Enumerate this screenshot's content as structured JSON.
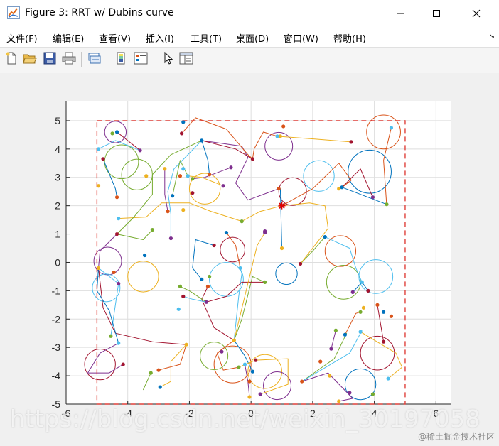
{
  "window": {
    "title": "Figure 3: RRT w/ Dubins curve",
    "minimize_icon": "minimize-icon",
    "maximize_icon": "maximize-icon",
    "close_icon": "close-icon"
  },
  "menu": {
    "items": [
      "文件(F)",
      "编辑(E)",
      "查看(V)",
      "插入(I)",
      "工具(T)",
      "桌面(D)",
      "窗口(W)",
      "帮助(H)"
    ]
  },
  "toolbar": {
    "icons": [
      "new-figure-icon",
      "open-file-icon",
      "save-icon",
      "print-icon",
      "link-plot-icon",
      "colorbar-icon",
      "legend-icon",
      "select-arrow-icon",
      "property-inspector-icon"
    ]
  },
  "chart_data": {
    "type": "line",
    "title": "",
    "xlabel": "",
    "ylabel": "",
    "xlim": [
      -6,
      6.5
    ],
    "ylim": [
      -5,
      5.7
    ],
    "xticks": [
      -6,
      -4,
      -2,
      0,
      2,
      4,
      6
    ],
    "yticks": [
      5,
      4,
      3,
      2,
      1,
      0,
      -1,
      -2,
      -3,
      -4,
      -5
    ],
    "grid": true,
    "boundary": {
      "x": [
        -5,
        5
      ],
      "y": [
        -5,
        5
      ],
      "color": "#e0403a",
      "style": "dashed"
    },
    "start_marker": {
      "x": 1,
      "y": 2,
      "symbol": "asterisk",
      "color": "#e00000"
    },
    "series_colors": [
      "#0072BD",
      "#D95319",
      "#EDB120",
      "#7E2F8E",
      "#77AC30",
      "#4DBEEE",
      "#A2142F"
    ],
    "nodes": [
      [
        1.0,
        2.0
      ],
      [
        0.9,
        2.6
      ],
      [
        1.0,
        0.5
      ],
      [
        0.45,
        1.1
      ],
      [
        -0.3,
        1.45
      ],
      [
        0.85,
        4.45
      ],
      [
        0.05,
        3.65
      ],
      [
        -1.6,
        4.3
      ],
      [
        -1.35,
        3.1
      ],
      [
        -2.2,
        1.85
      ],
      [
        -2.6,
        0.85
      ],
      [
        -3.2,
        1.15
      ],
      [
        -4.3,
        1.55
      ],
      [
        -4.35,
        1.0
      ],
      [
        -3.45,
        0.25
      ],
      [
        -4.45,
        -0.35
      ],
      [
        -4.95,
        -0.2
      ],
      [
        -4.3,
        -0.75
      ],
      [
        -4.55,
        -2.6
      ],
      [
        -4.3,
        -2.85
      ],
      [
        -4.15,
        -3.6
      ],
      [
        -2.95,
        -4.4
      ],
      [
        -3.0,
        -3.8
      ],
      [
        -2.1,
        -2.9
      ],
      [
        -1.45,
        -1.4
      ],
      [
        -2.3,
        -0.85
      ],
      [
        -2.35,
        -1.65
      ],
      [
        -2.2,
        -1.2
      ],
      [
        -1.6,
        -0.6
      ],
      [
        -1.4,
        -0.85
      ],
      [
        -0.55,
        -2.75
      ],
      [
        -0.95,
        -3.15
      ],
      [
        -0.4,
        -3.7
      ],
      [
        -0.2,
        -3.6
      ],
      [
        0.15,
        -3.45
      ],
      [
        0.05,
        -3.85
      ],
      [
        -0.05,
        -4.2
      ],
      [
        -0.05,
        -4.75
      ],
      [
        0.3,
        -4.65
      ],
      [
        0.45,
        -0.7
      ],
      [
        -0.35,
        -0.2
      ],
      [
        -1.2,
        0.6
      ],
      [
        -0.8,
        1.05
      ],
      [
        1.65,
        -4.2
      ],
      [
        2.85,
        -4.9
      ],
      [
        3.2,
        -4.6
      ],
      [
        3.95,
        -4.65
      ],
      [
        4.45,
        -4.1
      ],
      [
        4.3,
        -2.8
      ],
      [
        4.3,
        -1.75
      ],
      [
        4.55,
        -1.9
      ],
      [
        3.65,
        -1.6
      ],
      [
        3.3,
        -1.05
      ],
      [
        3.55,
        -1.75
      ],
      [
        3.6,
        -0.7
      ],
      [
        3.8,
        -1.0
      ],
      [
        3.05,
        -2.55
      ],
      [
        4.1,
        -1.5
      ],
      [
        2.55,
        -4.0
      ],
      [
        2.6,
        -3.05
      ],
      [
        2.75,
        -2.4
      ],
      [
        3.55,
        -2.45
      ],
      [
        1.6,
        -0.05
      ],
      [
        2.4,
        0.9
      ],
      [
        2.25,
        -3.5
      ],
      [
        2.85,
        2.6
      ],
      [
        3.95,
        2.3
      ],
      [
        4.4,
        2.05
      ],
      [
        4.55,
        4.75
      ],
      [
        3.25,
        4.25
      ],
      [
        2.95,
        2.65
      ],
      [
        1.05,
        4.8
      ],
      [
        0.95,
        4.45
      ],
      [
        -0.65,
        3.35
      ],
      [
        -1.9,
        2.95
      ],
      [
        -2.2,
        3.3
      ],
      [
        -1.9,
        2.45
      ],
      [
        -2.55,
        2.35
      ],
      [
        -2.3,
        3.05
      ],
      [
        -3.4,
        3.05
      ],
      [
        -3.6,
        3.95
      ],
      [
        -4.5,
        4.55
      ],
      [
        -4.95,
        4.0
      ],
      [
        -4.8,
        3.65
      ],
      [
        -4.35,
        4.6
      ],
      [
        -4.35,
        2.3
      ],
      [
        -4.95,
        2.7
      ],
      [
        -0.9,
        2.7
      ],
      [
        -1.35,
        -0.5
      ],
      [
        -2.05,
        3.05
      ],
      [
        -2.25,
        4.55
      ],
      [
        -2.2,
        4.95
      ],
      [
        -2.7,
        1.8
      ],
      [
        -2.8,
        3.3
      ],
      [
        0.45,
        1.05
      ],
      [
        -3.25,
        -3.9
      ]
    ],
    "edges": [
      [
        [
          1.0,
          2.0
        ],
        [
          0.95,
          2.6
        ],
        [
          1.0,
          0.5
        ]
      ],
      [
        [
          1.0,
          2.0
        ],
        [
          2.0,
          2.6
        ],
        [
          2.85,
          3.5
        ],
        [
          3.25,
          2.9
        ],
        [
          2.9,
          2.6
        ]
      ],
      [
        [
          1.0,
          2.0
        ],
        [
          0.3,
          1.8
        ],
        [
          -0.3,
          1.45
        ],
        [
          -1.3,
          1.8
        ],
        [
          -2.0,
          2.1
        ],
        [
          -2.9,
          2.1
        ],
        [
          -3.4,
          1.6
        ],
        [
          -4.3,
          1.55
        ]
      ],
      [
        [
          0.9,
          2.6
        ],
        [
          -0.1,
          2.2
        ],
        [
          -0.5,
          2.8
        ],
        [
          -0.1,
          3.7
        ],
        [
          -0.3,
          4.1
        ],
        [
          -1.6,
          4.3
        ]
      ],
      [
        [
          -1.6,
          4.3
        ],
        [
          -2.6,
          3.8
        ],
        [
          -3.2,
          3.1
        ],
        [
          -3.2,
          2.4
        ],
        [
          -3.8,
          1.6
        ],
        [
          -4.35,
          1.0
        ]
      ],
      [
        [
          -1.6,
          4.3
        ],
        [
          -2.5,
          3.3
        ],
        [
          -2.7,
          2.5
        ],
        [
          -2.6,
          1.7
        ],
        [
          -2.6,
          0.85
        ]
      ],
      [
        [
          -1.6,
          4.3
        ],
        [
          -0.5,
          4.0
        ],
        [
          0.05,
          3.65
        ]
      ],
      [
        [
          -1.6,
          4.3
        ],
        [
          -1.4,
          3.6
        ],
        [
          -1.35,
          3.1
        ]
      ],
      [
        [
          0.85,
          4.45
        ],
        [
          0.4,
          4.6
        ],
        [
          0.1,
          4.0
        ],
        [
          0.05,
          3.65
        ]
      ],
      [
        [
          0.85,
          4.45
        ],
        [
          2.1,
          4.35
        ],
        [
          3.25,
          4.25
        ]
      ],
      [
        [
          -4.35,
          1.0
        ],
        [
          -4.9,
          0.4
        ],
        [
          -4.95,
          -0.2
        ]
      ],
      [
        [
          -4.35,
          1.0
        ],
        [
          -3.5,
          0.8
        ],
        [
          -3.2,
          1.15
        ]
      ],
      [
        [
          -4.95,
          -0.2
        ],
        [
          -4.3,
          -0.75
        ],
        [
          -4.55,
          -2.6
        ]
      ],
      [
        [
          -4.95,
          -0.2
        ],
        [
          -4.8,
          -1.6
        ],
        [
          -4.4,
          -2.5
        ],
        [
          -3.2,
          -2.8
        ],
        [
          -2.1,
          -2.9
        ]
      ],
      [
        [
          -4.95,
          -0.2
        ],
        [
          -5.0,
          -1.0
        ],
        [
          -4.6,
          -1.7
        ],
        [
          -4.3,
          -2.85
        ]
      ],
      [
        [
          -2.1,
          -2.9
        ],
        [
          -2.3,
          -3.6
        ],
        [
          -3.0,
          -3.8
        ]
      ],
      [
        [
          -2.1,
          -2.9
        ],
        [
          -2.6,
          -3.5
        ],
        [
          -2.6,
          -4.2
        ],
        [
          -2.95,
          -4.4
        ]
      ],
      [
        [
          -4.3,
          -2.85
        ],
        [
          -4.9,
          -3.2
        ],
        [
          -5.3,
          -3.9
        ],
        [
          -4.6,
          -3.9
        ],
        [
          -4.15,
          -3.6
        ]
      ],
      [
        [
          -0.55,
          -2.75
        ],
        [
          -0.3,
          -2.0
        ],
        [
          0.05,
          -0.5
        ],
        [
          0.45,
          -0.7
        ]
      ],
      [
        [
          -0.55,
          -2.75
        ],
        [
          -0.4,
          -1.2
        ],
        [
          -0.3,
          -0.4
        ],
        [
          -0.35,
          -0.2
        ]
      ],
      [
        [
          -0.55,
          -2.75
        ],
        [
          -1.2,
          -2.3
        ],
        [
          -1.6,
          -1.3
        ],
        [
          -1.4,
          -0.85
        ]
      ],
      [
        [
          -0.55,
          -2.75
        ],
        [
          -0.2,
          -3.3
        ],
        [
          0.05,
          -3.85
        ]
      ],
      [
        [
          -0.55,
          -2.75
        ],
        [
          -1.1,
          -3.2
        ],
        [
          -0.9,
          -3.8
        ],
        [
          -0.4,
          -3.7
        ]
      ],
      [
        [
          -0.4,
          -3.7
        ],
        [
          0.15,
          -3.45
        ],
        [
          1.2,
          -3.4
        ],
        [
          1.2,
          -4.3
        ],
        [
          0.3,
          -4.65
        ]
      ],
      [
        [
          -0.2,
          -3.6
        ],
        [
          -0.1,
          -4.2
        ],
        [
          -0.05,
          -4.75
        ]
      ],
      [
        [
          -1.45,
          -1.4
        ],
        [
          -2.0,
          -1.0
        ],
        [
          -2.3,
          -0.85
        ]
      ],
      [
        [
          -1.45,
          -1.4
        ],
        [
          -1.9,
          -1.3
        ],
        [
          -2.2,
          -1.2
        ]
      ],
      [
        [
          -1.45,
          -1.4
        ],
        [
          -0.8,
          -1.2
        ],
        [
          -0.3,
          -0.7
        ],
        [
          0.45,
          -0.7
        ]
      ],
      [
        [
          -1.6,
          -0.6
        ],
        [
          -1.9,
          -0.2
        ],
        [
          -1.8,
          0.8
        ],
        [
          -1.2,
          0.6
        ]
      ],
      [
        [
          -0.8,
          1.05
        ],
        [
          -0.5,
          0.6
        ],
        [
          -0.35,
          -0.2
        ]
      ],
      [
        [
          0.45,
          1.05
        ],
        [
          0.2,
          0.6
        ],
        [
          -0.55,
          -2.75
        ]
      ],
      [
        [
          1.65,
          -4.2
        ],
        [
          2.5,
          -3.9
        ],
        [
          3.3,
          -4.8
        ],
        [
          2.85,
          -4.9
        ]
      ],
      [
        [
          1.65,
          -4.2
        ],
        [
          2.7,
          -3.4
        ],
        [
          3.1,
          -2.5
        ],
        [
          3.05,
          -2.55
        ]
      ],
      [
        [
          1.65,
          -4.2
        ],
        [
          3.2,
          -3.2
        ],
        [
          3.6,
          -2.4
        ]
      ],
      [
        [
          4.3,
          -2.8
        ],
        [
          4.1,
          -1.5
        ]
      ],
      [
        [
          3.3,
          -1.05
        ],
        [
          3.6,
          -0.7
        ],
        [
          3.8,
          -1.0
        ]
      ],
      [
        [
          3.05,
          -2.55
        ],
        [
          3.4,
          -1.8
        ],
        [
          3.55,
          -1.75
        ]
      ],
      [
        [
          3.55,
          -2.45
        ],
        [
          4.7,
          -3.2
        ],
        [
          4.9,
          -3.7
        ],
        [
          4.45,
          -4.1
        ]
      ],
      [
        [
          2.6,
          -3.05
        ],
        [
          2.75,
          -2.4
        ]
      ],
      [
        [
          1.6,
          -0.05
        ],
        [
          2.0,
          0.4
        ],
        [
          2.4,
          0.9
        ]
      ],
      [
        [
          2.4,
          0.9
        ],
        [
          3.2,
          0.5
        ],
        [
          3.4,
          -0.2
        ],
        [
          3.6,
          -0.7
        ]
      ],
      [
        [
          2.95,
          2.65
        ],
        [
          3.55,
          3.3
        ],
        [
          3.95,
          2.3
        ]
      ],
      [
        [
          2.95,
          2.65
        ],
        [
          4.4,
          2.05
        ]
      ],
      [
        [
          4.55,
          4.75
        ],
        [
          4.3,
          3.6
        ],
        [
          4.4,
          2.05
        ]
      ],
      [
        [
          1.0,
          2.0
        ],
        [
          1.9,
          2.1
        ],
        [
          2.4,
          2.0
        ],
        [
          2.5,
          1.2
        ],
        [
          1.6,
          -0.05
        ]
      ],
      [
        [
          -0.65,
          3.35
        ],
        [
          -1.5,
          3.0
        ],
        [
          -1.9,
          2.95
        ]
      ],
      [
        [
          -2.05,
          3.05
        ],
        [
          -2.3,
          3.6
        ],
        [
          -2.55,
          2.35
        ]
      ],
      [
        [
          -3.6,
          3.95
        ],
        [
          -4.4,
          4.3
        ],
        [
          -4.95,
          4.0
        ]
      ],
      [
        [
          -3.6,
          3.95
        ],
        [
          -4.35,
          4.6
        ]
      ],
      [
        [
          -4.8,
          3.65
        ],
        [
          -4.4,
          2.6
        ],
        [
          -4.35,
          2.3
        ]
      ],
      [
        [
          -2.25,
          4.55
        ],
        [
          -1.8,
          5.1
        ],
        [
          -0.8,
          4.7
        ],
        [
          -0.1,
          3.8
        ],
        [
          0.05,
          3.65
        ]
      ],
      [
        [
          -0.9,
          2.7
        ],
        [
          -1.6,
          3.0
        ],
        [
          -2.05,
          3.05
        ]
      ],
      [
        [
          -2.7,
          1.8
        ],
        [
          -2.8,
          2.4
        ],
        [
          -2.8,
          3.3
        ]
      ],
      [
        [
          -3.25,
          -3.9
        ],
        [
          -3.5,
          -4.5
        ]
      ]
    ],
    "loops": [
      [
        -4.4,
        4.6,
        0.35
      ],
      [
        -4.2,
        3.55,
        0.55
      ],
      [
        2.2,
        3.05,
        0.5
      ],
      [
        1.35,
        2.5,
        0.45
      ],
      [
        3.85,
        3.2,
        0.7
      ],
      [
        4.3,
        4.6,
        0.55
      ],
      [
        -3.5,
        -0.5,
        0.5
      ],
      [
        -4.65,
        0.05,
        0.45
      ],
      [
        3.0,
        -0.7,
        0.55
      ],
      [
        4.05,
        -0.5,
        0.55
      ],
      [
        4.1,
        -3.2,
        0.55
      ],
      [
        3.55,
        -4.3,
        0.5
      ],
      [
        -0.6,
        -3.6,
        0.6
      ],
      [
        0.45,
        -3.85,
        0.55
      ],
      [
        0.85,
        -4.35,
        0.45
      ],
      [
        -1.2,
        -3.3,
        0.45
      ],
      [
        -0.8,
        -0.6,
        0.55
      ],
      [
        -0.6,
        0.45,
        0.4
      ],
      [
        1.15,
        -0.4,
        0.35
      ],
      [
        2.9,
        0.4,
        0.5
      ],
      [
        -1.5,
        2.6,
        0.5
      ],
      [
        0.9,
        4.1,
        0.45
      ],
      [
        -3.7,
        3.1,
        0.5
      ],
      [
        -4.7,
        -0.9,
        0.45
      ],
      [
        -4.9,
        -3.6,
        0.5
      ]
    ]
  },
  "watermark": {
    "text": "https://blog.csdn.net/weixin_30197058",
    "corner_text": "@稀土掘金技术社区"
  }
}
